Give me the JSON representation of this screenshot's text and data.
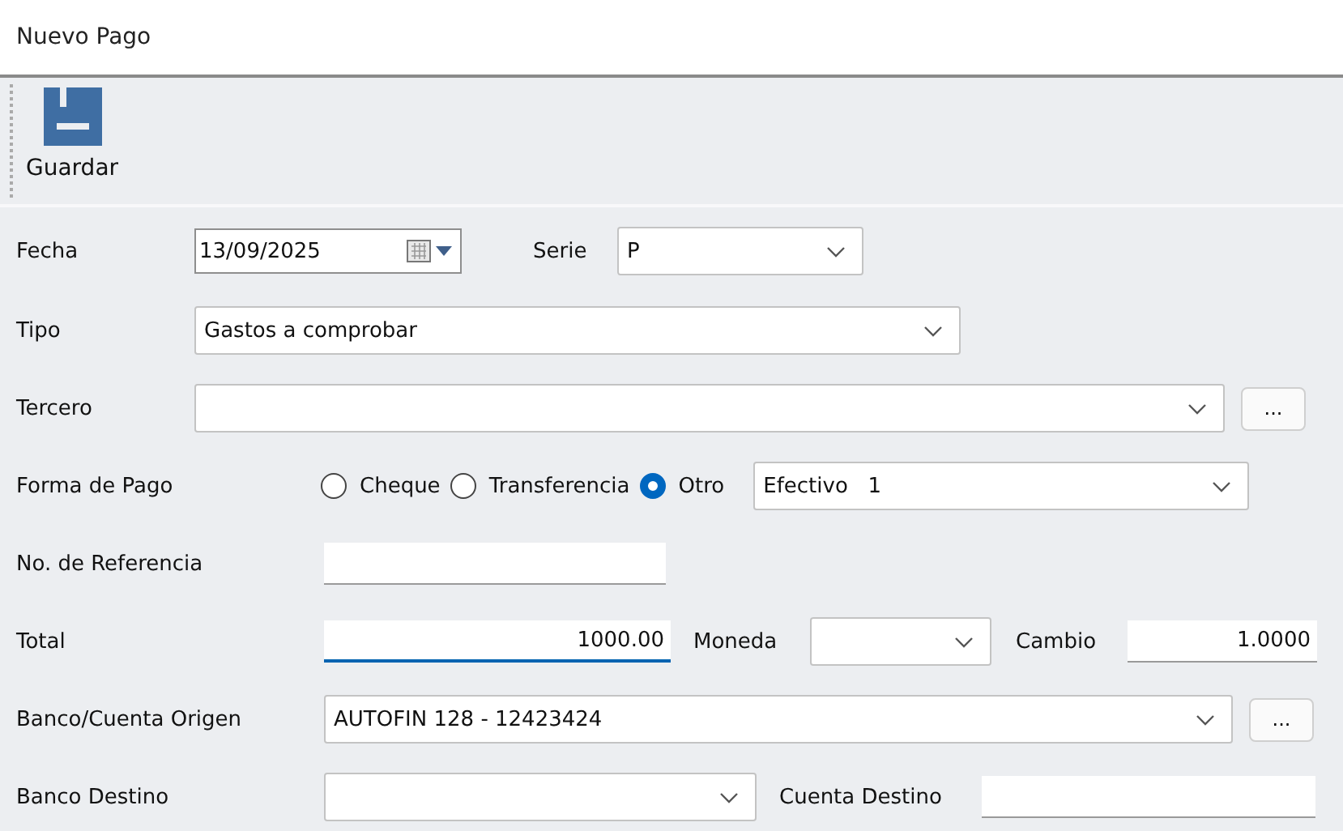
{
  "window": {
    "title": "Nuevo Pago"
  },
  "toolbar": {
    "buttons": [
      {
        "label": "Guardar"
      }
    ]
  },
  "form": {
    "fecha": {
      "label": "Fecha",
      "value": "13/09/2025"
    },
    "serie": {
      "label": "Serie",
      "value": "P"
    },
    "tipo": {
      "label": "Tipo",
      "value": "Gastos a comprobar"
    },
    "tercero": {
      "label": "Tercero",
      "button": "..."
    },
    "forma_de_pago": {
      "label": "Forma de Pago",
      "options": [
        {
          "label": "Cheque",
          "selected": false
        },
        {
          "label": "Transferencia",
          "selected": false
        },
        {
          "label": "Otro",
          "selected": true
        }
      ],
      "value": "Efectivo   1"
    },
    "referencia": {
      "label": "No. de Referencia"
    },
    "total": {
      "label": "Total",
      "value": "1000.00",
      "focused": true
    },
    "moneda": {
      "label": "Moneda"
    },
    "cambio": {
      "label": "Cambio",
      "value": "1.0000"
    },
    "banco_origen": {
      "label": "Banco/Cuenta Origen",
      "value": "AUTOFIN 128 - 12423424",
      "button": "..."
    },
    "banco_destino": {
      "label": "Banco Destino"
    },
    "cuenta_destino": {
      "label": "Cuenta Destino"
    }
  }
}
